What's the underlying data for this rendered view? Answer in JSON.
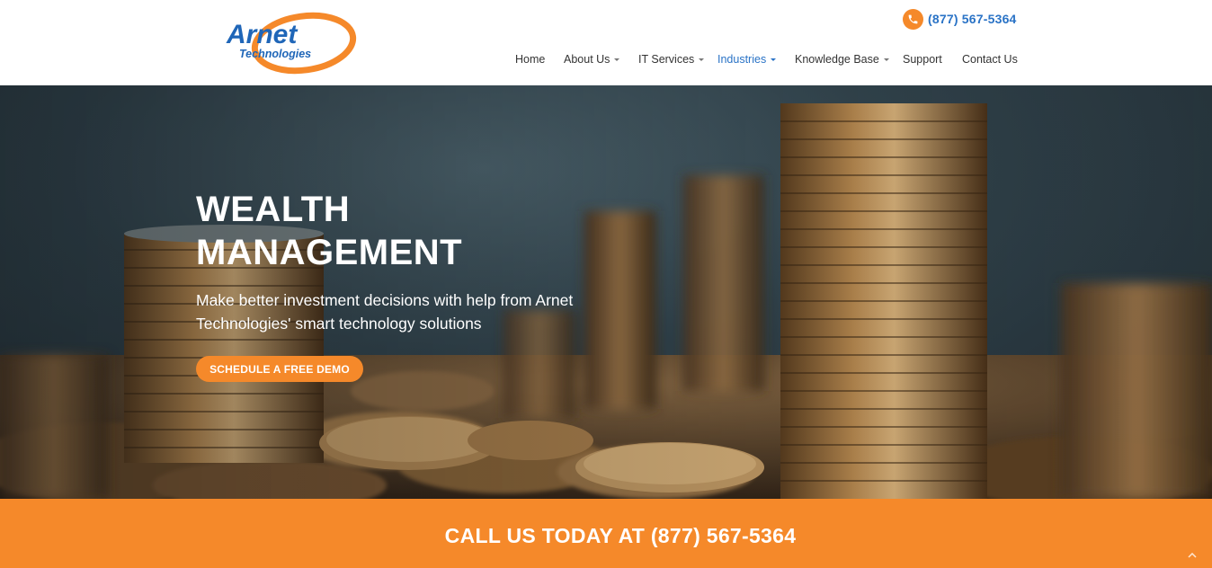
{
  "header": {
    "logo": {
      "line1": "Arnet",
      "line2": "Technologies"
    },
    "phone": "(877) 567-5364",
    "nav": [
      {
        "label": "Home",
        "dropdown": false,
        "active": false
      },
      {
        "label": "About Us",
        "dropdown": true,
        "active": false
      },
      {
        "label": "IT Services",
        "dropdown": true,
        "active": false
      },
      {
        "label": "Industries",
        "dropdown": true,
        "active": true
      },
      {
        "label": "Knowledge Base",
        "dropdown": true,
        "active": false
      },
      {
        "label": "Support",
        "dropdown": false,
        "active": false
      },
      {
        "label": "Contact Us",
        "dropdown": false,
        "active": false
      }
    ]
  },
  "hero": {
    "title_line1": "WEALTH",
    "title_line2": "MANAGEMENT",
    "subtitle_line1": "Make better investment decisions with help from Arnet",
    "subtitle_line2": "Technologies' smart technology solutions",
    "button": "SCHEDULE A FREE DEMO"
  },
  "cta": {
    "text": "CALL US TODAY AT (877) 567-5364"
  },
  "colors": {
    "accent": "#f5892a",
    "brand_blue": "#2a73c6",
    "nav_text": "#333333",
    "white": "#ffffff"
  },
  "icons": {
    "phone": "phone-icon",
    "caret": "chevron-down-icon",
    "scroll_top": "chevron-up-icon"
  }
}
